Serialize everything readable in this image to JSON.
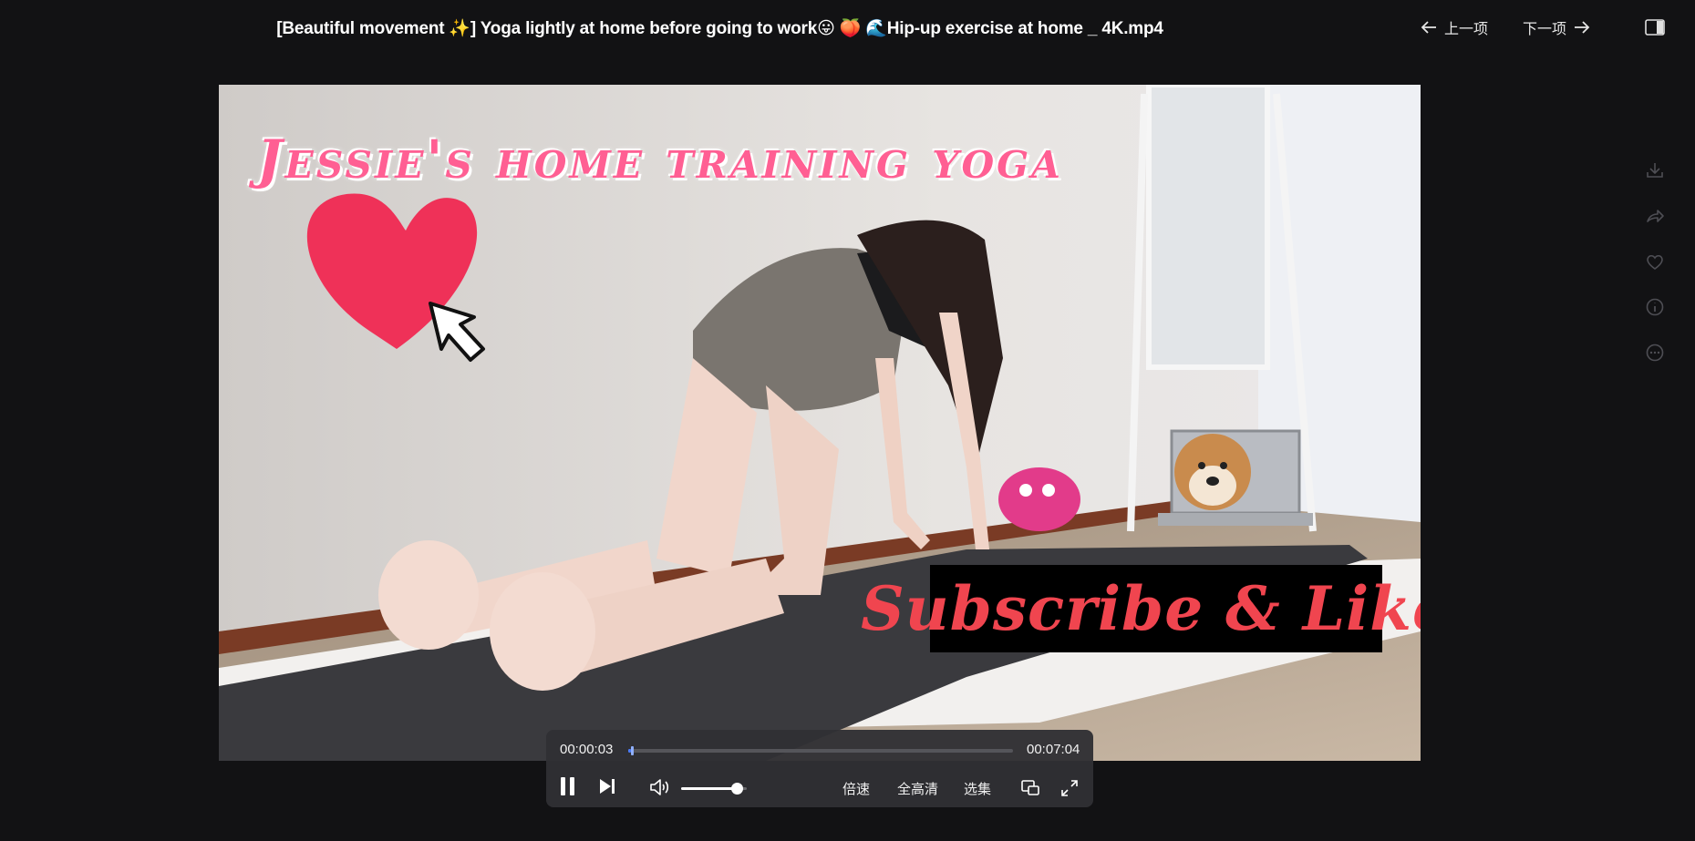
{
  "header": {
    "title": "[Beautiful movement ✨] Yoga lightly at home before going to work😛 🍑 🌊Hip-up exercise at home _ 4K.mp4",
    "prev_label": "上一项",
    "next_label": "下一项"
  },
  "video": {
    "overlay_title": "Jessie's home training yoga",
    "subscribe_text": "Subscribe & Like"
  },
  "player": {
    "current_time": "00:00:03",
    "total_time": "00:07:04",
    "progress": 0.007,
    "volume": 0.85,
    "speed_label": "倍速",
    "quality_label": "全高清",
    "episodes_label": "选集"
  },
  "side_tools": [
    "download-icon",
    "share-icon",
    "heart-icon",
    "info-icon",
    "more-icon"
  ],
  "colors": {
    "background": "#121214",
    "accent": "#4a7cff",
    "overlay_pink": "#ff5f93",
    "subscribe_red": "#f0454f"
  }
}
